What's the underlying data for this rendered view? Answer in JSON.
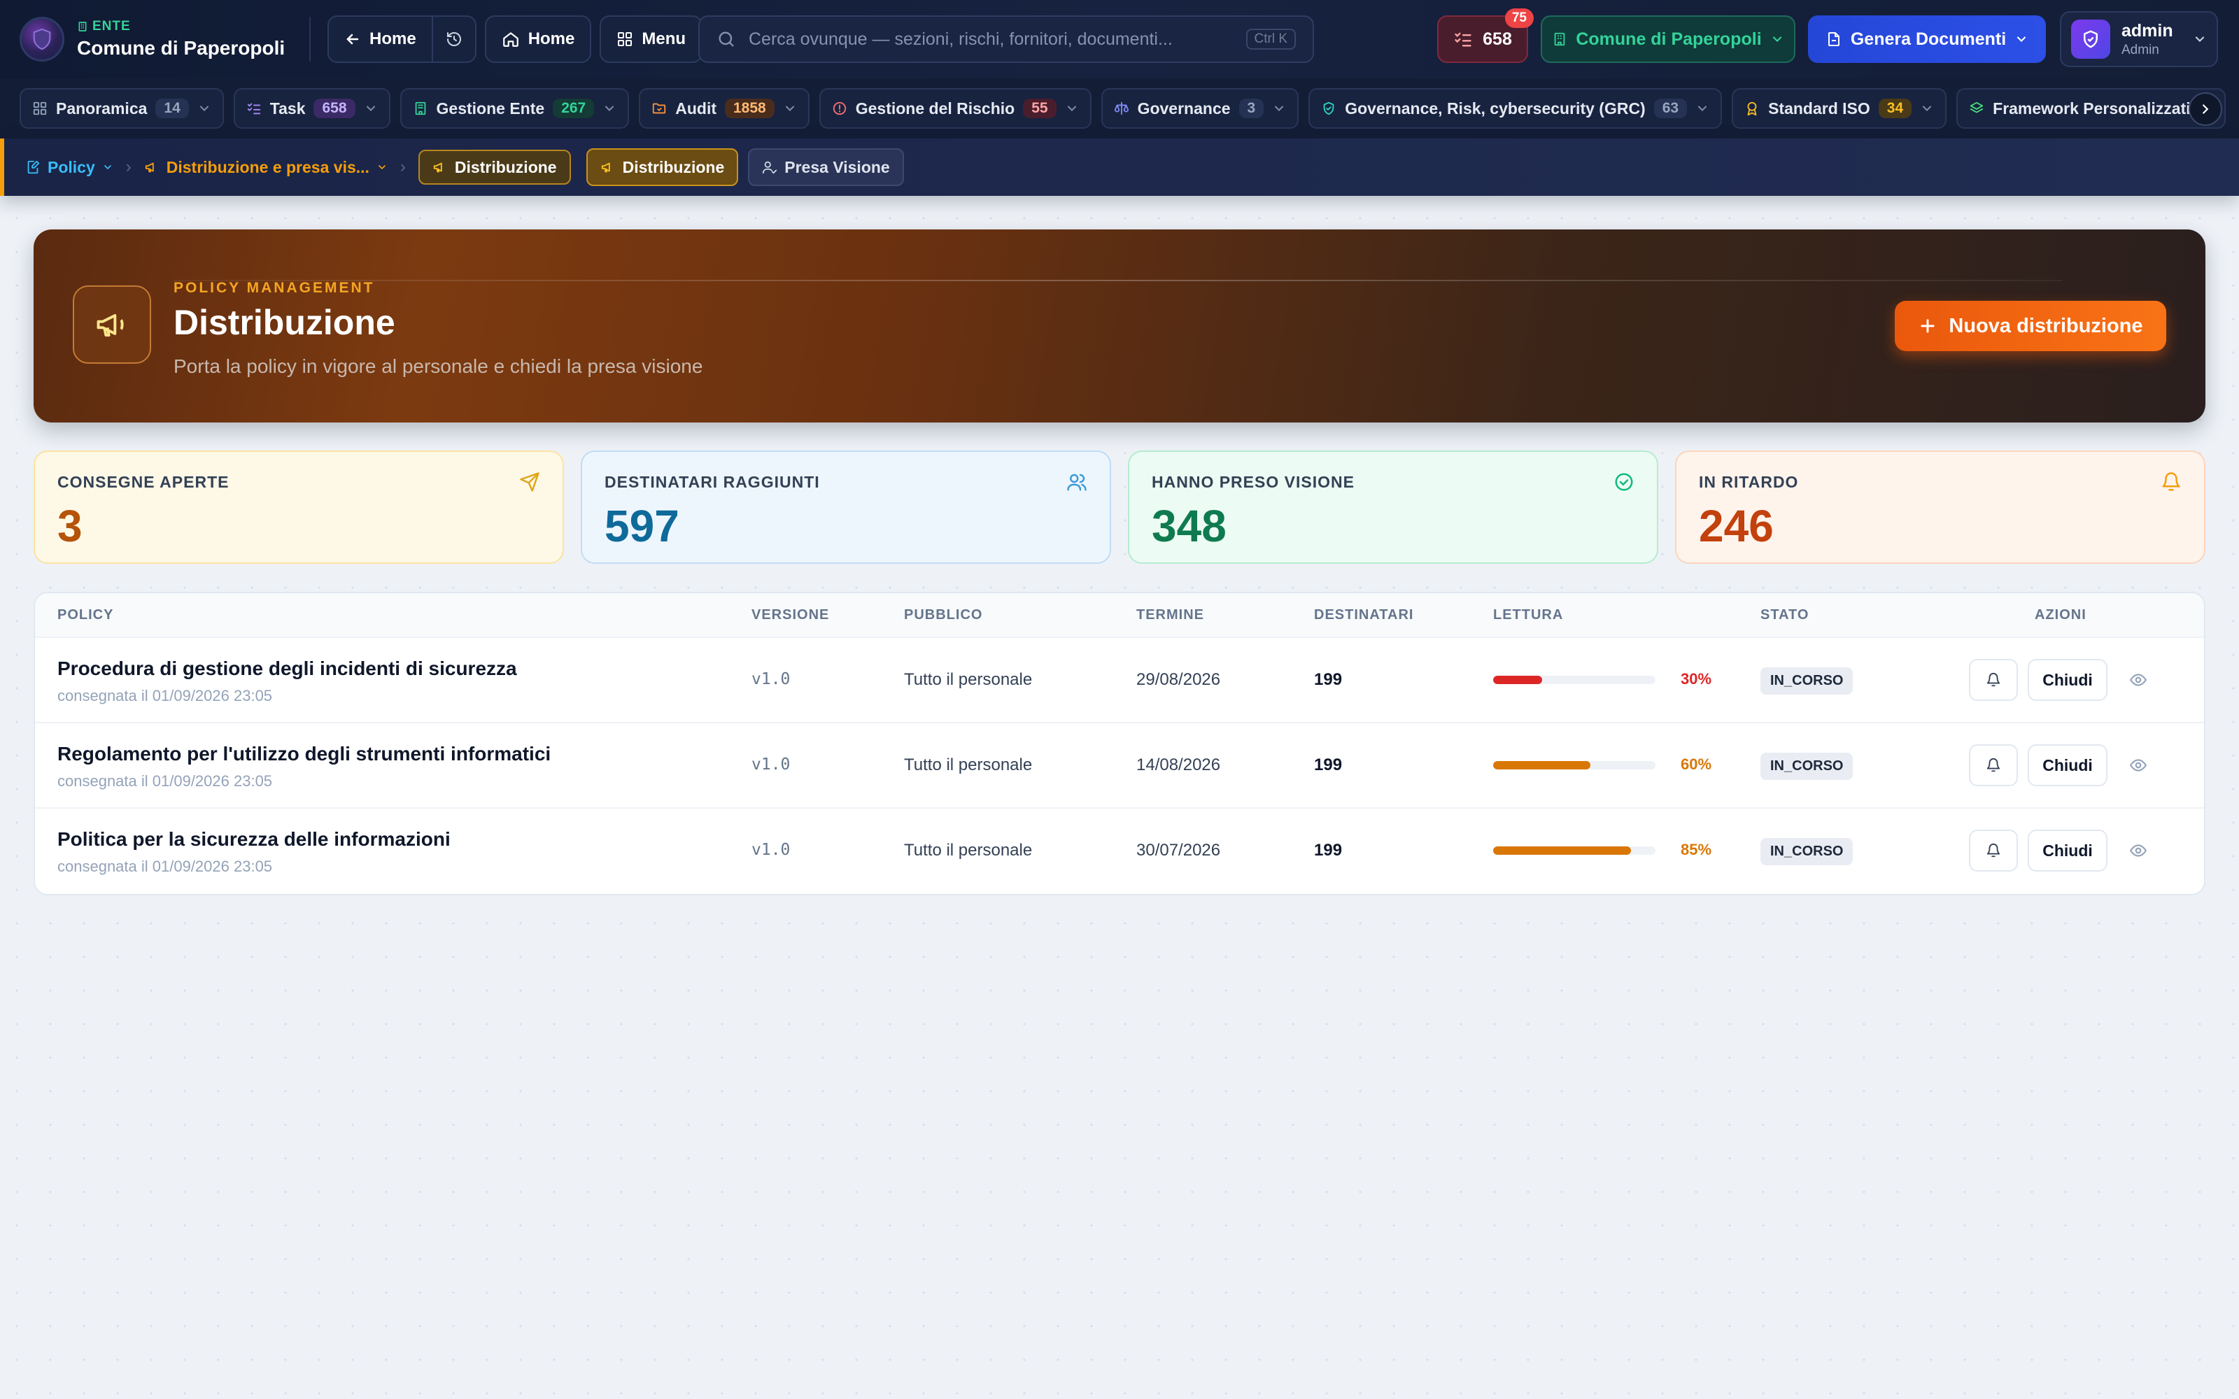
{
  "header": {
    "ente_label": "ENTE",
    "ente_name": "Comune di Paperopoli",
    "back_label": "Home",
    "home_label": "Home",
    "menu_label": "Menu",
    "search_placeholder": "Cerca ovunque — sezioni, rischi, fornitori, documenti...",
    "search_shortcut": "Ctrl K",
    "tasks_count": "658",
    "tasks_badge": "75",
    "ente_selector": "Comune di Paperopoli",
    "generate_label": "Genera Documenti",
    "user_name": "admin",
    "user_role": "Admin"
  },
  "modules": [
    {
      "label": "Panoramica",
      "count": "14",
      "icon": "grid-icon",
      "color": "#94a3b8",
      "count_color": "#9aa5bf",
      "count_bg": "#263253"
    },
    {
      "label": "Task",
      "count": "658",
      "icon": "checklist-icon",
      "color": "#a78bfa",
      "count_color": "#c4b5fd",
      "count_bg": "#3b2a66"
    },
    {
      "label": "Gestione Ente",
      "count": "267",
      "icon": "building-icon",
      "color": "#34d399",
      "count_color": "#34d399",
      "count_bg": "#143b35"
    },
    {
      "label": "Audit",
      "count": "1858",
      "icon": "folder-icon",
      "color": "#fb923c",
      "count_color": "#fdba74",
      "count_bg": "#4a2c1c"
    },
    {
      "label": "Gestione del Rischio",
      "count": "55",
      "icon": "alert-circle-icon",
      "color": "#f87171",
      "count_color": "#fca5a5",
      "count_bg": "#4a1d2d"
    },
    {
      "label": "Governance",
      "count": "3",
      "icon": "scale-icon",
      "color": "#818cf8",
      "count_color": "#9aa5bf",
      "count_bg": "#263253"
    },
    {
      "label": "Governance, Risk, cybersecurity (GRC)",
      "count": "63",
      "icon": "shield-icon",
      "color": "#2dd4bf",
      "count_color": "#9aa5bf",
      "count_bg": "#263253"
    },
    {
      "label": "Standard ISO",
      "count": "34",
      "icon": "award-icon",
      "color": "#fbbf24",
      "count_color": "#fbbf24",
      "count_bg": "#4a3a17"
    },
    {
      "label": "Framework Personalizzati",
      "count": "",
      "icon": "layers-icon",
      "color": "#4ade80",
      "count_color": "#9aa5bf",
      "count_bg": "#263253"
    }
  ],
  "breadcrumb": {
    "root": "Policy",
    "section": "Distribuzione e presa vis...",
    "current": "Distribuzione",
    "tab_active": "Distribuzione",
    "tab_other": "Presa Visione"
  },
  "hero": {
    "eyebrow": "POLICY MANAGEMENT",
    "title": "Distribuzione",
    "subtitle": "Porta la policy in vigore al personale e chiedi la presa visione",
    "cta": "Nuova distribuzione"
  },
  "stats": [
    {
      "label": "CONSEGNE APERTE",
      "value": "3",
      "icon": "send-icon"
    },
    {
      "label": "DESTINATARI RAGGIUNTI",
      "value": "597",
      "icon": "users-icon"
    },
    {
      "label": "HANNO PRESO VISIONE",
      "value": "348",
      "icon": "check-circle-icon"
    },
    {
      "label": "IN RITARDO",
      "value": "246",
      "icon": "bell-icon"
    }
  ],
  "table": {
    "columns": [
      "POLICY",
      "VERSIONE",
      "PUBBLICO",
      "TERMINE",
      "DESTINATARI",
      "LETTURA",
      "STATO",
      "AZIONI"
    ],
    "close_label": "Chiudi",
    "rows": [
      {
        "title": "Procedura di gestione degli incidenti di sicurezza",
        "delivered": "consegnata il 01/09/2026 23:05",
        "version": "v1.0",
        "audience": "Tutto il personale",
        "deadline": "29/08/2026",
        "recipients": "199",
        "reading": 0.3,
        "reading_label": "30%",
        "reading_color": "#dc2626",
        "status": "IN_CORSO"
      },
      {
        "title": "Regolamento per l'utilizzo degli strumenti informatici",
        "delivered": "consegnata il 01/09/2026 23:05",
        "version": "v1.0",
        "audience": "Tutto il personale",
        "deadline": "14/08/2026",
        "recipients": "199",
        "reading": 0.6,
        "reading_label": "60%",
        "reading_color": "#d97706",
        "status": "IN_CORSO"
      },
      {
        "title": "Politica per la sicurezza delle informazioni",
        "delivered": "consegnata il 01/09/2026 23:05",
        "version": "v1.0",
        "audience": "Tutto il personale",
        "deadline": "30/07/2026",
        "recipients": "199",
        "reading": 0.85,
        "reading_label": "85%",
        "reading_color": "#d97706",
        "status": "IN_CORSO"
      }
    ]
  }
}
